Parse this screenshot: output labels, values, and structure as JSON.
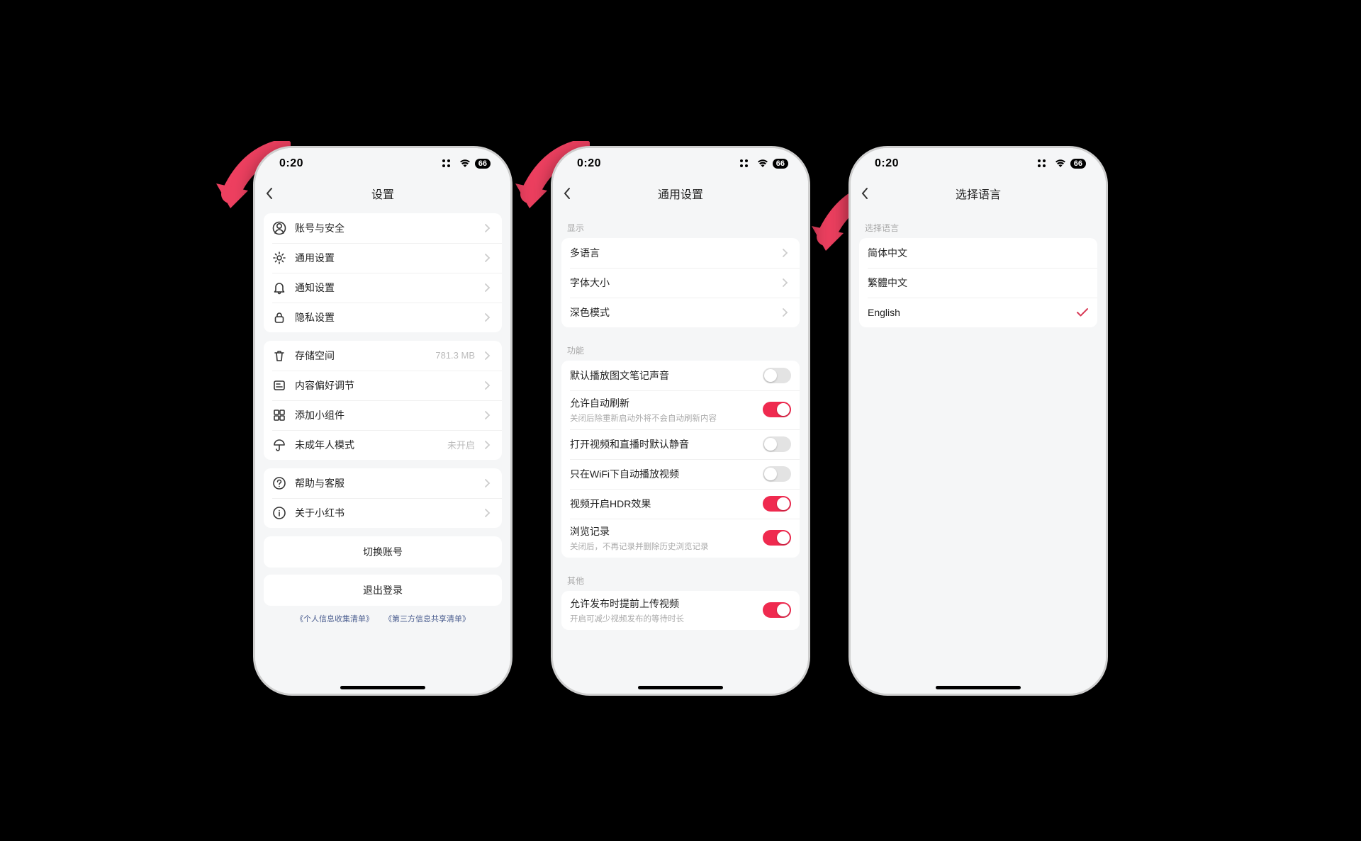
{
  "status": {
    "time": "0:20",
    "battery": "66"
  },
  "phone1": {
    "title": "设置",
    "group1": [
      {
        "icon": "user",
        "label": "账号与安全"
      },
      {
        "icon": "gear",
        "label": "通用设置"
      },
      {
        "icon": "bell",
        "label": "通知设置"
      },
      {
        "icon": "lock",
        "label": "隐私设置"
      }
    ],
    "group2": [
      {
        "icon": "trash",
        "label": "存储空间",
        "value": "781.3 MB"
      },
      {
        "icon": "sliders",
        "label": "内容偏好调节"
      },
      {
        "icon": "widget",
        "label": "添加小组件"
      },
      {
        "icon": "umbrella",
        "label": "未成年人模式",
        "value": "未开启"
      }
    ],
    "group3": [
      {
        "icon": "help",
        "label": "帮助与客服"
      },
      {
        "icon": "info",
        "label": "关于小红书"
      }
    ],
    "buttons": {
      "switch": "切换账号",
      "logout": "退出登录"
    },
    "links": {
      "a": "《个人信息收集清单》",
      "b": "《第三方信息共享清单》"
    }
  },
  "phone2": {
    "title": "通用设置",
    "sec_display": "显示",
    "display": [
      {
        "label": "多语言"
      },
      {
        "label": "字体大小"
      },
      {
        "label": "深色模式"
      }
    ],
    "sec_func": "功能",
    "func": [
      {
        "label": "默认播放图文笔记声音",
        "on": false
      },
      {
        "label": "允许自动刷新",
        "sub": "关闭后除重新启动外将不会自动刷新内容",
        "on": true
      },
      {
        "label": "打开视频和直播时默认静音",
        "on": false
      },
      {
        "label": "只在WiFi下自动播放视频",
        "on": false
      },
      {
        "label": "视频开启HDR效果",
        "on": true
      },
      {
        "label": "浏览记录",
        "sub": "关闭后，不再记录并删除历史浏览记录",
        "on": true
      }
    ],
    "sec_other": "其他",
    "other": [
      {
        "label": "允许发布时提前上传视频",
        "sub": "开启可减少视频发布的等待时长",
        "on": true
      }
    ]
  },
  "phone3": {
    "title": "选择语言",
    "section": "选择语言",
    "langs": [
      {
        "label": "简体中文",
        "selected": false
      },
      {
        "label": "繁體中文",
        "selected": false
      },
      {
        "label": "English",
        "selected": true
      }
    ]
  }
}
